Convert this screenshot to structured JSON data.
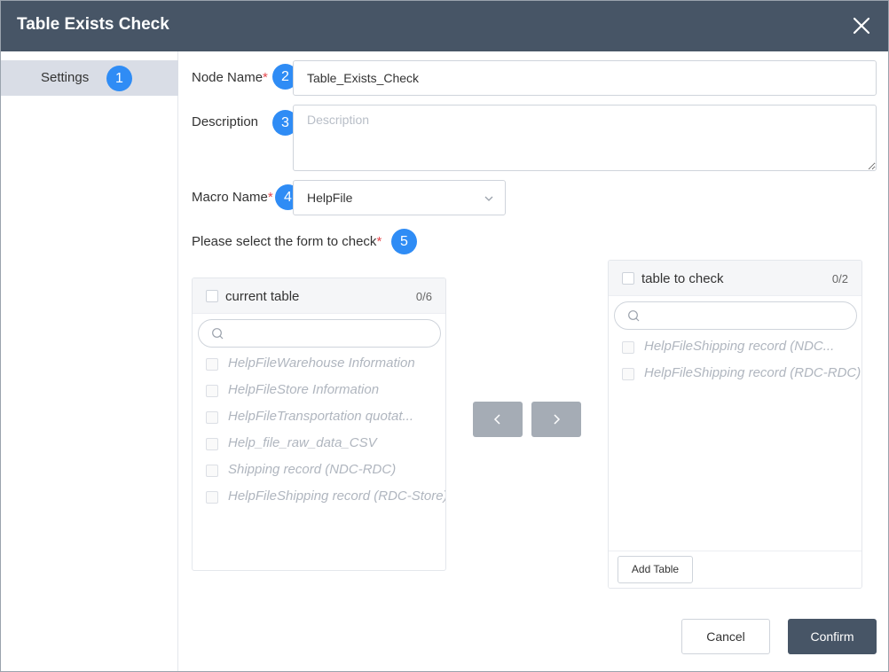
{
  "dialog": {
    "title": "Table Exists Check",
    "close_icon": "close-icon"
  },
  "sidebar": {
    "items": [
      {
        "label": "Settings",
        "badge": "1"
      }
    ]
  },
  "form": {
    "node_name": {
      "label": "Node Name",
      "required": "*",
      "badge": "2",
      "value": "Table_Exists_Check"
    },
    "description": {
      "label": "Description",
      "badge": "3",
      "placeholder": "Description",
      "value": ""
    },
    "macro_name": {
      "label": "Macro Name",
      "required": "*",
      "badge": "4",
      "value": "HelpFile"
    },
    "form_select": {
      "label": "Please select the form to check",
      "required": "*",
      "badge": "5"
    }
  },
  "current_table": {
    "title": "current table",
    "count": "0/6",
    "search_placeholder": "",
    "items": [
      "HelpFileWarehouse Information",
      "HelpFileStore Information",
      "HelpFileTransportation quotat...",
      "Help_file_raw_data_CSV",
      "Shipping record (NDC-RDC)",
      "HelpFileShipping record (RDC-Store)"
    ]
  },
  "transfer": {
    "left_icon": "chevron-left-icon",
    "right_icon": "chevron-right-icon"
  },
  "table_to_check": {
    "title": "table to check",
    "count": "0/2",
    "search_placeholder": "",
    "items": [
      "HelpFileShipping record (NDC...",
      "HelpFileShipping record (RDC-RDC)"
    ],
    "add_button": "Add Table"
  },
  "footer": {
    "cancel": "Cancel",
    "confirm": "Confirm"
  },
  "colors": {
    "titlebar": "#475566",
    "badge": "#2f8cf5",
    "required": "#e5484d",
    "sidebar_active": "#d9dde6",
    "transfer_button": "#a5acb5"
  }
}
